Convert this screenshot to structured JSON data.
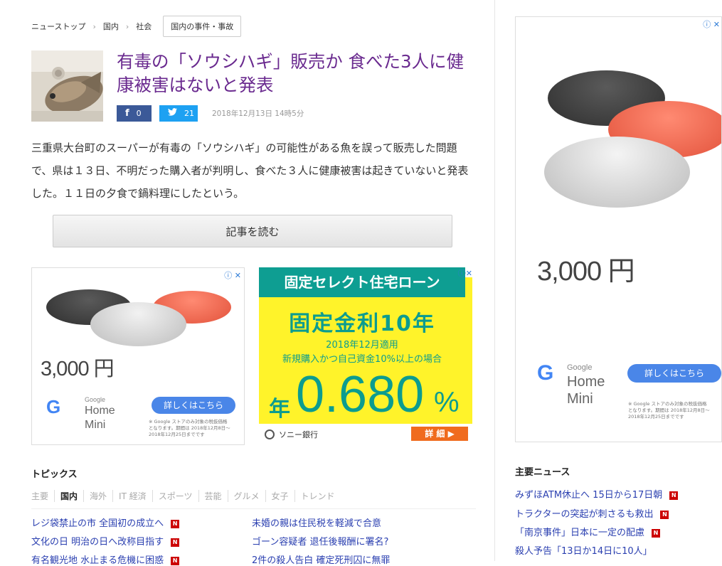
{
  "breadcrumb": {
    "items": [
      "ニューストップ",
      "国内",
      "社会"
    ],
    "current": "国内の事件・事故"
  },
  "article": {
    "title": "有毒の「ソウシハギ」販売か 食べた3人に健康被害はないと発表",
    "facebook_count": "0",
    "twitter_count": "21",
    "date": "2018年12月13日 14時5分",
    "summary": "三重県大台町のスーパーが有毒の「ソウシハギ」の可能性がある魚を誤って販売した問題で、県は１３日、不明だった購入者が判明し、食べた３人に健康被害は起きていないと発表した。１１日の夕食で鍋料理にしたという。",
    "read_more": "記事を読む"
  },
  "icons": {
    "facebook": "facebook-icon",
    "twitter": "twitter-icon",
    "adchoices": "adchoices-icon",
    "close": "close-icon",
    "sony_bank_logo": "sony-bank-logo",
    "news_badge": "n-badge-icon"
  },
  "ad_google": {
    "price": "3,000 円",
    "brand_small": "Google",
    "product_line1": "Home",
    "product_line2": "Mini",
    "cta": "詳しくはこちら",
    "fine_print_1": "※ Google ストアのみ対象の税抜価格",
    "fine_print_2": "となります。期間は 2018年12月8日〜",
    "fine_print_3": "2018年12月25日までです",
    "colors": {
      "charcoal": "#4a4a4a",
      "coral": "#f26b54",
      "chalk": "#d9d9d9",
      "cta": "#4a86e8"
    }
  },
  "ad_loan": {
    "heading": "固定セレクト住宅ローン",
    "rate_title": "固定金利10年",
    "line1": "2018年12月適用",
    "line2": "新規購入かつ自己資金10%以上の場合",
    "rate_prefix": "年",
    "rate": "0.680",
    "rate_suffix": "%",
    "bank": "ソニー銀行",
    "detail": "詳 細",
    "colors": {
      "background": "#fff32a",
      "teal": "#0e9e92",
      "orange": "#f06b1e"
    }
  },
  "topics": {
    "title": "トピックス",
    "tabs": [
      "主要",
      "国内",
      "海外",
      "IT 経済",
      "スポーツ",
      "芸能",
      "グルメ",
      "女子",
      "トレンド"
    ],
    "active_tab": "国内",
    "left": [
      {
        "text": "レジ袋禁止の市 全国初の成立へ",
        "badge": "N"
      },
      {
        "text": "文化の日 明治の日へ改称目指す",
        "badge": "N"
      },
      {
        "text": "有名観光地 水止まる危機に困惑",
        "badge": "N"
      }
    ],
    "right": [
      {
        "text": "未婚の親は住民税を軽減で合意"
      },
      {
        "text": "ゴーン容疑者 退任後報酬に署名?"
      },
      {
        "text": "2件の殺人告白 確定死刑囚に無罪"
      }
    ]
  },
  "main_news": {
    "title": "主要ニュース",
    "items": [
      {
        "text": "みずほATM休止へ 15日から17日朝",
        "badge": "N"
      },
      {
        "text": "トラクターの突起が刺さるも救出",
        "badge": "N"
      },
      {
        "text": "「南京事件」日本に一定の配慮",
        "badge": "N"
      },
      {
        "text": "殺人予告「13日か14日に10人」",
        "badge": ""
      }
    ]
  }
}
